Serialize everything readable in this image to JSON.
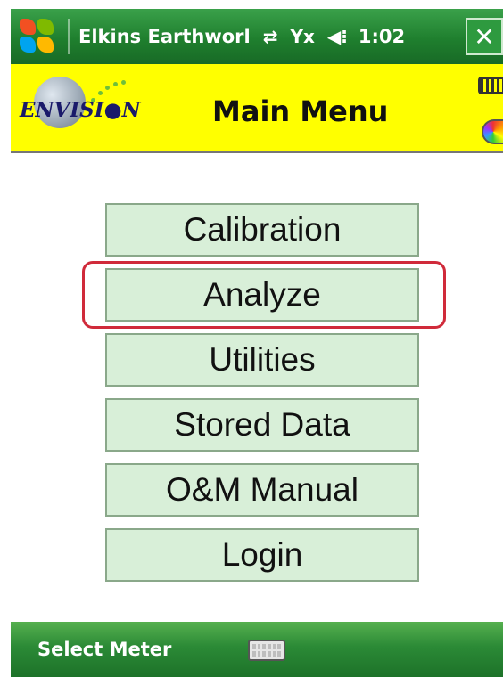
{
  "titlebar": {
    "app_title": "Elkins Earthworl",
    "clock": "1:02",
    "close_glyph": "✕",
    "sync_glyph": "⇄",
    "signal_glyph": "Yx",
    "volume_glyph": "◀⁝"
  },
  "header": {
    "logo_text": "ENVISI●N",
    "title": "Main Menu"
  },
  "menu": {
    "items": [
      "Calibration",
      "Analyze",
      "Utilities",
      "Stored Data",
      "O&M Manual",
      "Login"
    ],
    "highlighted": "Analyze"
  },
  "bottombar": {
    "left_softkey": "Select Meter"
  },
  "colors": {
    "bar_green": "#1f7f2e",
    "header_yellow": "#ffff00",
    "button_fill": "#d8efd8",
    "highlight_red": "#d02a3a"
  },
  "icons": [
    "windows-start-icon",
    "sync-icon",
    "signal-icon",
    "volume-icon",
    "close-icon",
    "battery-icon",
    "color-wheel-icon",
    "keyboard-icon"
  ]
}
